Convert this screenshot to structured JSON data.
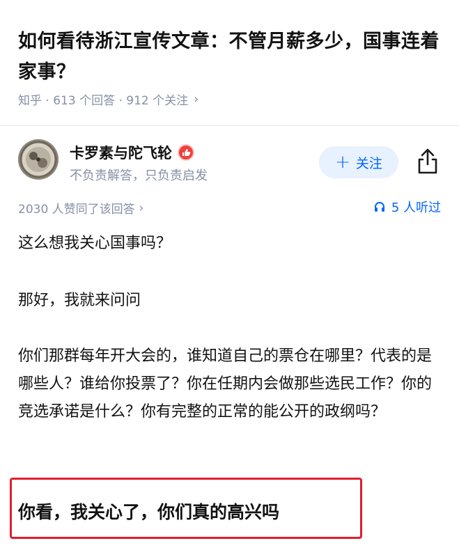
{
  "question": {
    "title": "如何看待浙江宣传文章：不管月薪多少，国事连着家事？",
    "meta": "知乎 · 613 个回答 · 912 个关注",
    "meta_chevron": "›"
  },
  "author": {
    "name": "卡罗素与陀飞轮",
    "bio": "不负责解答，只负责启发",
    "follow_label": "关注",
    "follow_plus": "+"
  },
  "answer": {
    "votes_text": "2030 人赞同了该回答",
    "votes_chevron": "›",
    "listen_text": "5 人听过",
    "paragraphs": [
      "这么想我关心国事吗？",
      "那好，我就来问问",
      "你们那群每年开大会的，谁知道自己的票仓在哪里？代表的是哪些人？谁给你投票了？你在任期内会做那些选民工作？你的竞选承诺是什么？你有完整的正常的能公开的政纲吗？"
    ],
    "highlight": "你看，我关心了，你们真的高兴吗"
  },
  "colors": {
    "accent": "#0066ff",
    "muted": "#8590a6",
    "highlight_border": "#e11d2e",
    "follow_bg": "#e8f1fe"
  },
  "icons": [
    "verified-badge-icon",
    "share-icon",
    "headphones-icon",
    "chevron-right-icon"
  ]
}
